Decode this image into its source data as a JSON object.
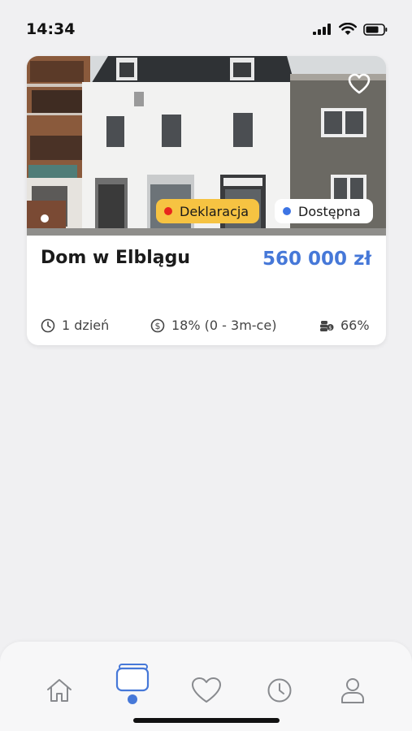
{
  "status_bar": {
    "time": "14:34",
    "icons": [
      "cellular-signal-icon",
      "wifi-icon",
      "battery-icon"
    ]
  },
  "listing": {
    "image_alt": "property-photo",
    "badges": [
      {
        "label": "Deklaracja",
        "dot_color": "#e8261c",
        "bg_color": "#f6c342"
      },
      {
        "label": "Dostępna",
        "dot_color": "#3d74e4",
        "bg_color": "#ffffff"
      }
    ],
    "title": "Dom w Elblągu",
    "price": "560 000 zł",
    "stats": [
      {
        "icon": "clock-icon",
        "text": "1 dzień"
      },
      {
        "icon": "dollar-circle-icon",
        "text": "18% (0 - 3m-ce)"
      },
      {
        "icon": "coins-icon",
        "text": "66%"
      }
    ]
  },
  "bottom_nav": {
    "items": [
      "home",
      "browse",
      "favorites",
      "history",
      "profile"
    ],
    "active": "browse"
  },
  "colors": {
    "accent": "#4678d8",
    "background": "#f0f0f2",
    "card": "#ffffff"
  }
}
